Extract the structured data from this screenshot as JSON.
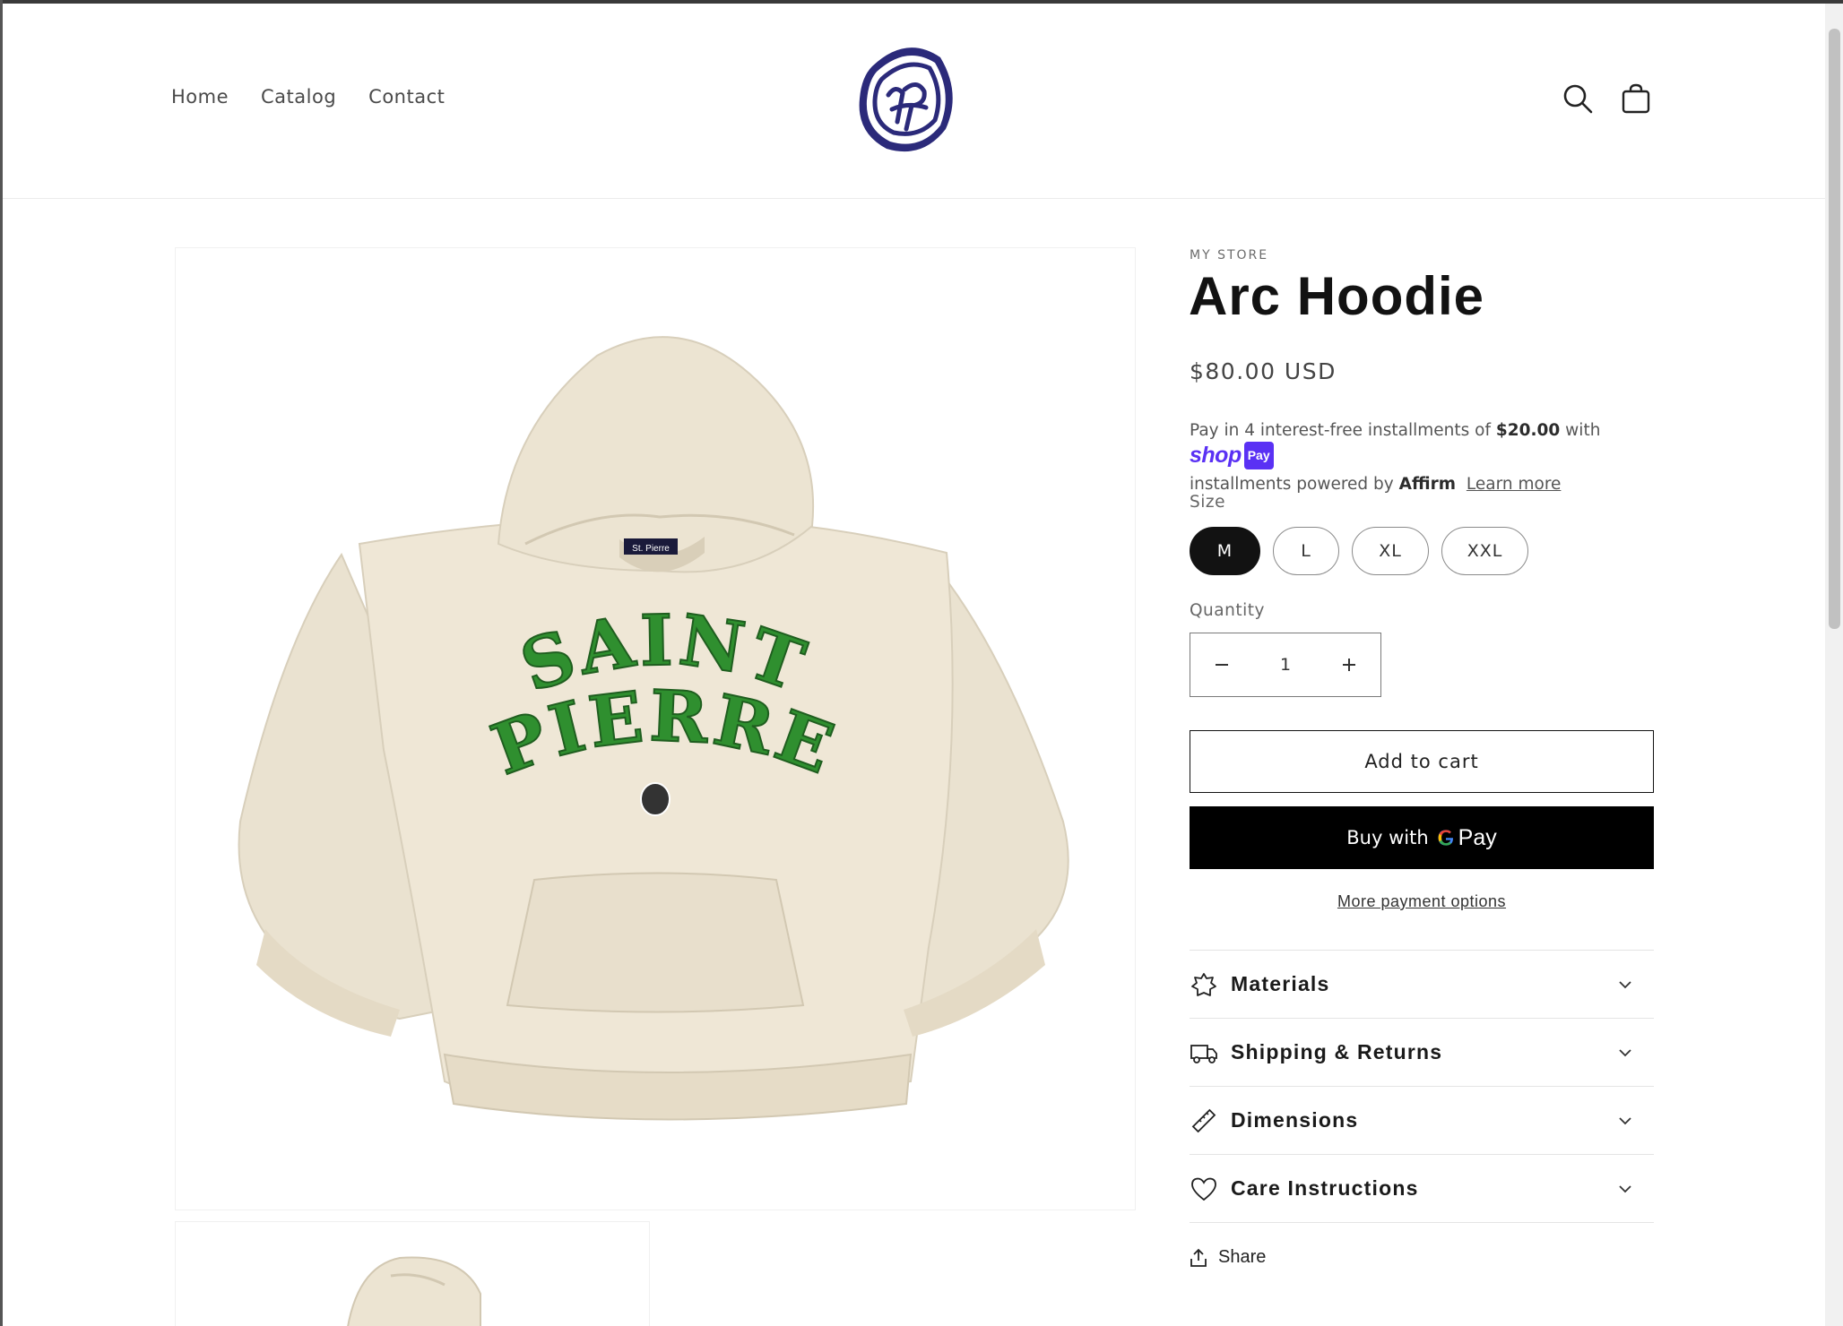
{
  "header": {
    "nav": [
      "Home",
      "Catalog",
      "Contact"
    ],
    "logo_icon": "saint-pierre-logo"
  },
  "product": {
    "vendor": "MY STORE",
    "title": "Arc Hoodie",
    "price": "$80.00 USD",
    "installments": {
      "prefix": "Pay in 4 interest-free installments of",
      "amount": "$20.00",
      "with": "with",
      "shop_brand": "shop",
      "shop_pay": "Pay",
      "line2_prefix": "installments powered by",
      "affirm": "Affirm",
      "learn_more": "Learn more"
    },
    "size_label": "Size",
    "sizes": [
      "M",
      "L",
      "XL",
      "XXL"
    ],
    "selected_size": "M",
    "quantity_label": "Quantity",
    "quantity": "1",
    "add_to_cart": "Add to cart",
    "gpay_prefix": "Buy with",
    "gpay_brand": "Pay",
    "more_payment": "More payment options",
    "accordions": [
      {
        "label": "Materials",
        "icon": "materials-icon"
      },
      {
        "label": "Shipping & Returns",
        "icon": "truck-icon"
      },
      {
        "label": "Dimensions",
        "icon": "ruler-icon"
      },
      {
        "label": "Care Instructions",
        "icon": "heart-icon"
      }
    ],
    "share": "Share"
  },
  "image": {
    "print_line1": "SAINT",
    "print_line2": "PIERRE",
    "tag": "St. Pierre"
  },
  "colors": {
    "accent": "#121212",
    "shop_pay": "#5a31f4",
    "print_green": "#2f8f2f",
    "hoodie": "#ece4d3"
  }
}
